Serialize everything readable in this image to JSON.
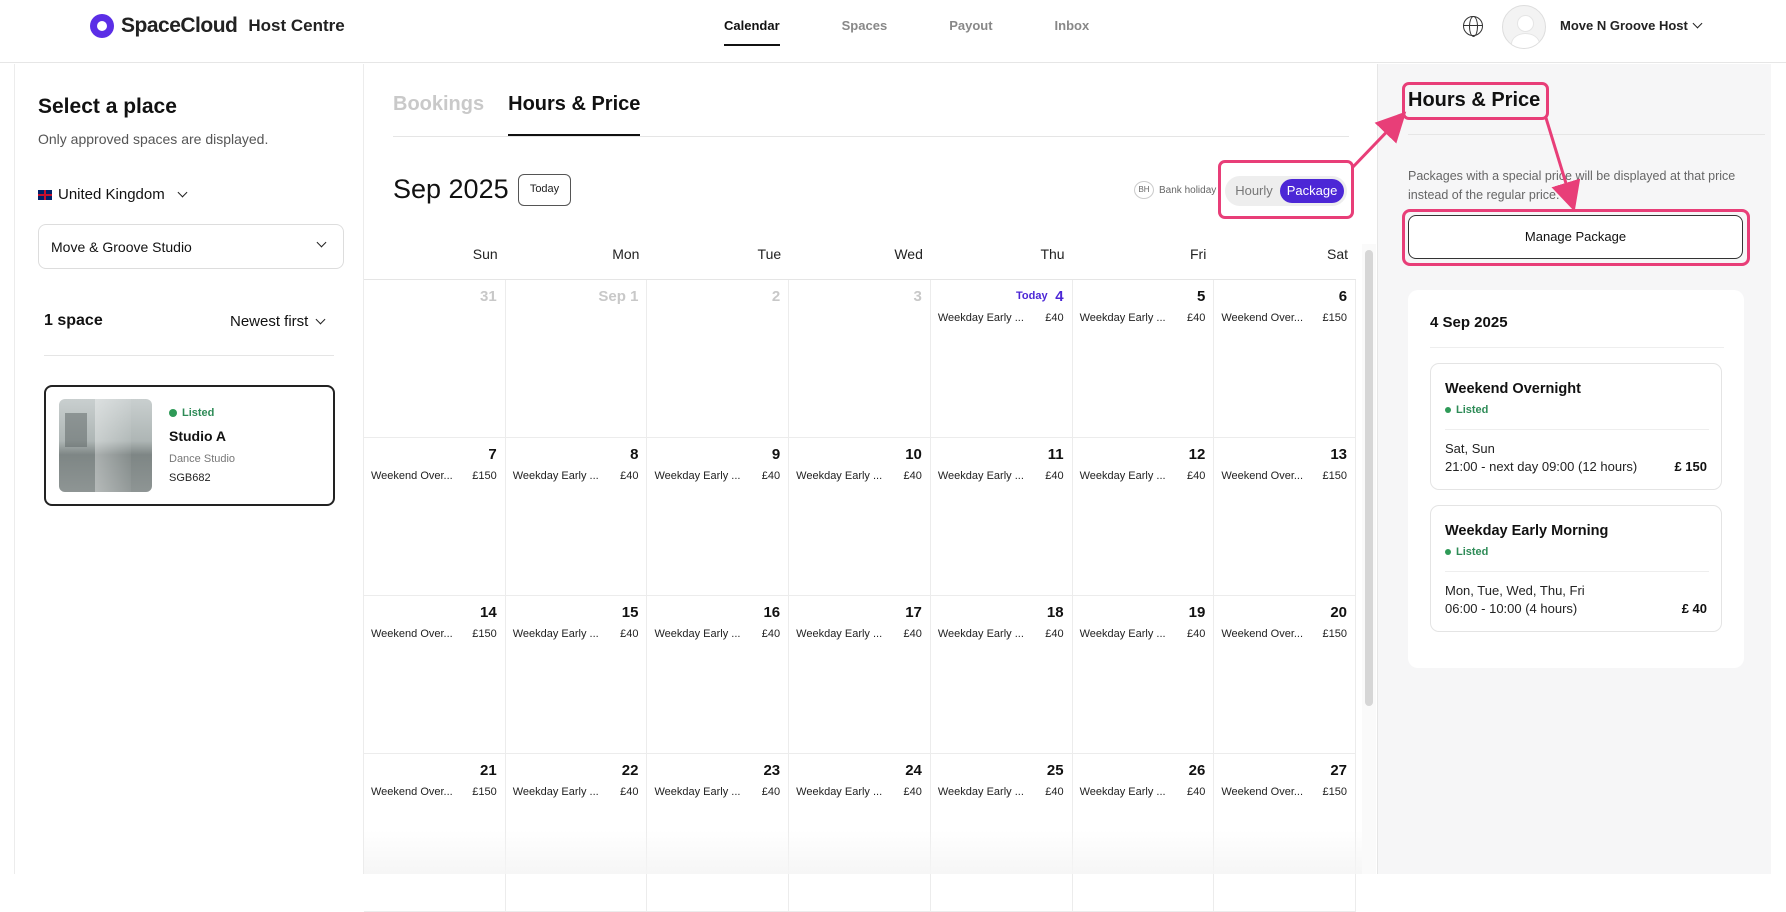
{
  "header": {
    "brand": "SpaceCloud",
    "brand_sub": "Host Centre",
    "nav": [
      "Calendar",
      "Spaces",
      "Payout",
      "Inbox"
    ],
    "active_nav": "Calendar",
    "host_name": "Move N Groove Host"
  },
  "left": {
    "title": "Select a place",
    "subtitle": "Only approved spaces are displayed.",
    "country": "United Kingdom",
    "place_select": "Move & Groove Studio",
    "space_count": "1 space",
    "sort": "Newest first",
    "space_card": {
      "status": "Listed",
      "name": "Studio A",
      "type": "Dance Studio",
      "code": "SGB682"
    }
  },
  "main": {
    "tabs": [
      "Bookings",
      "Hours & Price"
    ],
    "active_tab": "Hours & Price",
    "month": "Sep 2025",
    "today_button": "Today",
    "bank_holiday_badge": "BH",
    "bank_holiday_label": "Bank holiday",
    "toggle": {
      "hourly": "Hourly",
      "package": "Package",
      "selected": "Package"
    },
    "weekdays": [
      "Sun",
      "Mon",
      "Tue",
      "Wed",
      "Thu",
      "Fri",
      "Sat"
    ],
    "today_label": "Today",
    "weeks": [
      [
        {
          "day": "31",
          "muted": true
        },
        {
          "day": "Sep 1",
          "muted": true
        },
        {
          "day": "2",
          "muted": true
        },
        {
          "day": "3",
          "muted": true
        },
        {
          "day": "4",
          "today": true,
          "event": "Weekday Early ...",
          "price": "£40"
        },
        {
          "day": "5",
          "event": "Weekday Early ...",
          "price": "£40"
        },
        {
          "day": "6",
          "event": "Weekend Over...",
          "price": "£150"
        }
      ],
      [
        {
          "day": "7",
          "event": "Weekend Over...",
          "price": "£150"
        },
        {
          "day": "8",
          "event": "Weekday Early ...",
          "price": "£40"
        },
        {
          "day": "9",
          "event": "Weekday Early ...",
          "price": "£40"
        },
        {
          "day": "10",
          "event": "Weekday Early ...",
          "price": "£40"
        },
        {
          "day": "11",
          "event": "Weekday Early ...",
          "price": "£40"
        },
        {
          "day": "12",
          "event": "Weekday Early ...",
          "price": "£40"
        },
        {
          "day": "13",
          "event": "Weekend Over...",
          "price": "£150"
        }
      ],
      [
        {
          "day": "14",
          "event": "Weekend Over...",
          "price": "£150"
        },
        {
          "day": "15",
          "event": "Weekday Early ...",
          "price": "£40"
        },
        {
          "day": "16",
          "event": "Weekday Early ...",
          "price": "£40"
        },
        {
          "day": "17",
          "event": "Weekday Early ...",
          "price": "£40"
        },
        {
          "day": "18",
          "event": "Weekday Early ...",
          "price": "£40"
        },
        {
          "day": "19",
          "event": "Weekday Early ...",
          "price": "£40"
        },
        {
          "day": "20",
          "event": "Weekend Over...",
          "price": "£150"
        }
      ],
      [
        {
          "day": "21",
          "event": "Weekend Over...",
          "price": "£150"
        },
        {
          "day": "22",
          "event": "Weekday Early ...",
          "price": "£40"
        },
        {
          "day": "23",
          "event": "Weekday Early ...",
          "price": "£40"
        },
        {
          "day": "24",
          "event": "Weekday Early ...",
          "price": "£40"
        },
        {
          "day": "25",
          "event": "Weekday Early ...",
          "price": "£40"
        },
        {
          "day": "26",
          "event": "Weekday Early ...",
          "price": "£40"
        },
        {
          "day": "27",
          "event": "Weekend Over...",
          "price": "£150"
        }
      ]
    ]
  },
  "right": {
    "title": "Hours & Price",
    "note": "Packages with a special price will be displayed at that price instead of the regular price.",
    "manage_button": "Manage Package",
    "date": "4 Sep 2025",
    "packages": [
      {
        "name": "Weekend Overnight",
        "status": "Listed",
        "days": "Sat, Sun",
        "time": "21:00 - next day 09:00 (12 hours)",
        "price": "£ 150"
      },
      {
        "name": "Weekday Early Morning",
        "status": "Listed",
        "days": "Mon, Tue, Wed, Thu, Fri",
        "time": "06:00 - 10:00 (4 hours)",
        "price": "£ 40"
      }
    ]
  },
  "colors": {
    "accent": "#4c27d6",
    "highlight": "#e83e78",
    "listed": "#2e8b57"
  }
}
